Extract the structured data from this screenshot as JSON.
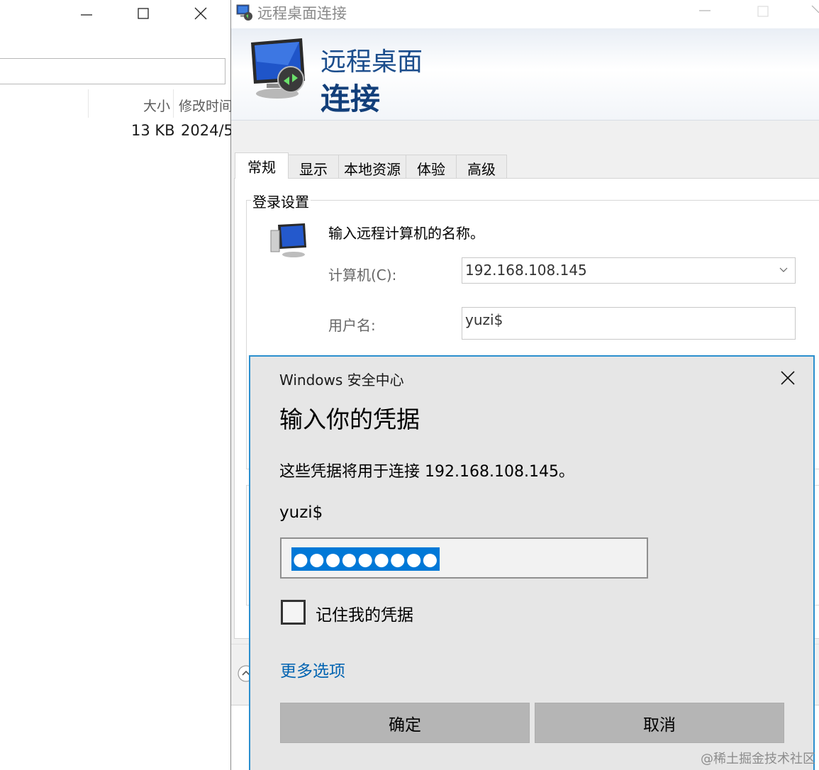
{
  "explorer": {
    "columns": [
      "大小",
      "修改时间"
    ],
    "row": {
      "size": "13 KB",
      "modified": "2024/5"
    }
  },
  "rdc": {
    "title": "远程桌面连接",
    "banner": {
      "line1": "远程桌面",
      "line2": "连接"
    },
    "tabs": [
      "常规",
      "显示",
      "本地资源",
      "体验",
      "高级"
    ],
    "active_tab": "常规",
    "logon": {
      "group_title": "登录设置",
      "prompt": "输入远程计算机的名称。",
      "computer_label": "计算机(C):",
      "computer_value": "192.168.108.145",
      "username_label": "用户名:",
      "username_value": "yuzi$"
    }
  },
  "security_dialog": {
    "brand": "Windows 安全中心",
    "heading": "输入你的凭据",
    "description": "这些凭据将用于连接 192.168.108.145。",
    "username": "yuzi$",
    "password_mask": "●●●●●●●●●",
    "remember_label": "记住我的凭据",
    "remember_checked": false,
    "more_options": "更多选项",
    "ok_label": "确定",
    "cancel_label": "取消"
  },
  "watermark": "@稀土掘金技术社区",
  "colors": {
    "accent": "#0078d7",
    "link": "#0063b1",
    "dialog_border": "#2b8fce",
    "banner_text": "#1b4d8c"
  }
}
